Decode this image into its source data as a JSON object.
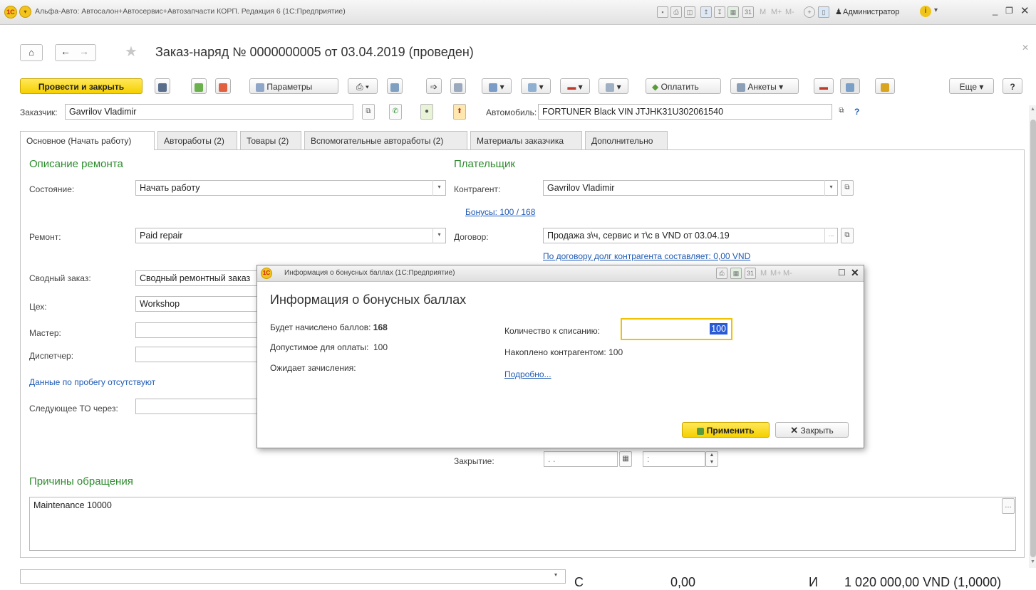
{
  "window": {
    "title": "Альфа-Авто: Автосалон+Автосервис+Автозапчасти КОРП. Редакция 6  (1С:Предприятие)",
    "logo_text": "1C",
    "memory_buttons": [
      "M",
      "M+",
      "M-"
    ],
    "user": "Администратор"
  },
  "header": {
    "doc_title": "Заказ-наряд № 0000000005 от 03.04.2019 (проведен)"
  },
  "toolbar": {
    "post_close": "Провести и закрыть",
    "params": "Параметры",
    "pay": "Оплатить",
    "profiles": "Анкеты",
    "more": "Еще",
    "help": "?"
  },
  "customer_row": {
    "customer_label": "Заказчик:",
    "customer_value": "Gavrilov Vladimir",
    "car_label": "Автомобиль:",
    "car_value": "FORTUNER Black VIN JTJHK31U302061540",
    "car_help": "?"
  },
  "tabs": [
    {
      "label": "Основное (Начать работу)"
    },
    {
      "label": "Автоработы (2)"
    },
    {
      "label": "Товары (2)"
    },
    {
      "label": "Вспомогательные автоработы (2)"
    },
    {
      "label": "Материалы заказчика"
    },
    {
      "label": "Дополнительно"
    }
  ],
  "left": {
    "section_title": "Описание ремонта",
    "state_label": "Состояние:",
    "state_value": "Начать работу",
    "repair_label": "Ремонт:",
    "repair_value": "Paid repair",
    "summary_label": "Сводный заказ:",
    "summary_value": "Сводный ремонтный заказ",
    "shop_label": "Цех:",
    "shop_value": "Workshop",
    "master_label": "Мастер:",
    "dispatcher_label": "Диспетчер:",
    "mileage_link": "Данные по пробегу отсутствуют",
    "next_to_label": "Следующее ТО через:"
  },
  "right": {
    "section_title": "Плательщик",
    "contractor_label": "Контрагент:",
    "contractor_value": "Gavrilov Vladimir",
    "bonus_link": "Бонусы: 100 / 168",
    "contract_label": "Договор:",
    "contract_value": "Продажа з\\ч, сервис и т\\с в VND от 03.04.19",
    "debt_link": "По договору долг контрагента составляет: 0,00 VND",
    "closing_label": "Закрытие:",
    "closing_date": " . .",
    "closing_time": " :"
  },
  "reasons": {
    "section_title": "Причины обращения",
    "text": "Maintenance 10000"
  },
  "modal": {
    "title": "Информация о бонусных баллах  (1С:Предприятие)",
    "heading": "Информация о бонусных баллах",
    "accrue_label": "Будет начислено баллов:",
    "accrue_value": "168",
    "allowed_label": "Допустимое для оплаты:",
    "allowed_value": "100",
    "pending_label": "Ожидает зачисления:",
    "writeoff_label": "Количество к списанию:",
    "writeoff_value": "100",
    "accumulated_label": "Накоплено контрагентом: 100",
    "details_link": "Подробно...",
    "apply": "Применить",
    "close": "Закрыть"
  },
  "footer": {
    "partial_text_1": "С",
    "partial_text_2": "0,00",
    "partial_text_3": "И",
    "partial_text_4": "1 020 000,00 VND (1,0000)"
  },
  "colors": {
    "primary_button": "#f5d000",
    "section_green": "#2e8b2e",
    "link_blue": "#1f5bb5",
    "writeoff_focus": "#f2c200"
  }
}
